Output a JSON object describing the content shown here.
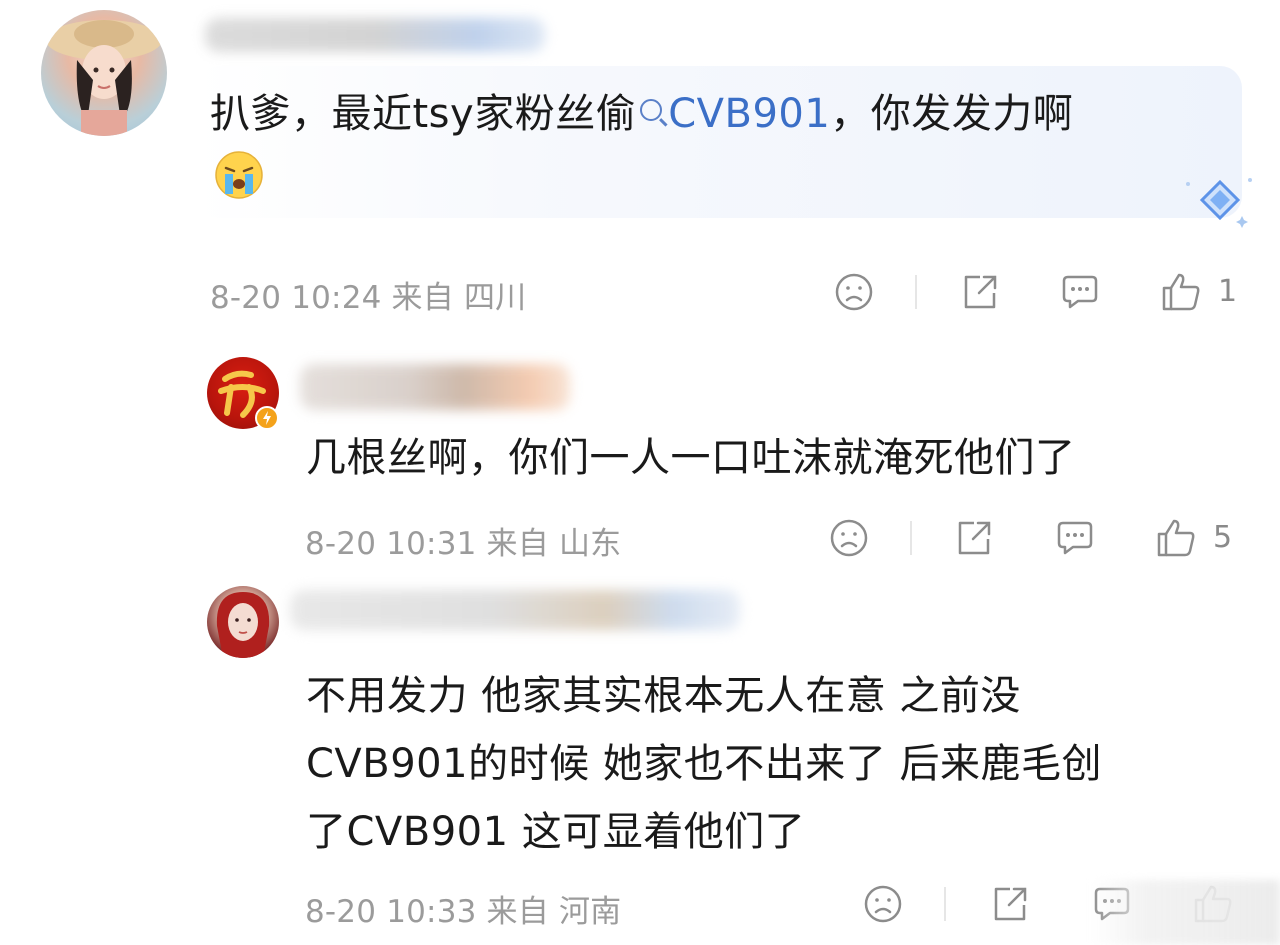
{
  "comments": [
    {
      "text_before": "扒爹，最近tsy家粉丝偷",
      "search_tag": "CVB901",
      "text_after": "，你发发力啊",
      "emoji": "crying-face-emoji",
      "time": "8-20 10:24",
      "from_label": "来自",
      "location": "四川",
      "like_count": "1"
    },
    {
      "text": "几根丝啊，你们一人一口吐沫就淹死他们了",
      "time": "8-20 10:31",
      "from_label": "来自",
      "location": "山东",
      "like_count": "5"
    },
    {
      "lines": [
        "不用发力 他家其实根本无人在意  之前没",
        "CVB901的时候 她家也不出来了 后来鹿毛创",
        "了CVB901 这可显着他们了"
      ],
      "time": "8-20 10:33",
      "from_label": "来自",
      "location": "河南"
    }
  ],
  "colors": {
    "meta": "#9b9b9b",
    "link": "#3b6fc7",
    "icon": "#8c8c8c"
  }
}
